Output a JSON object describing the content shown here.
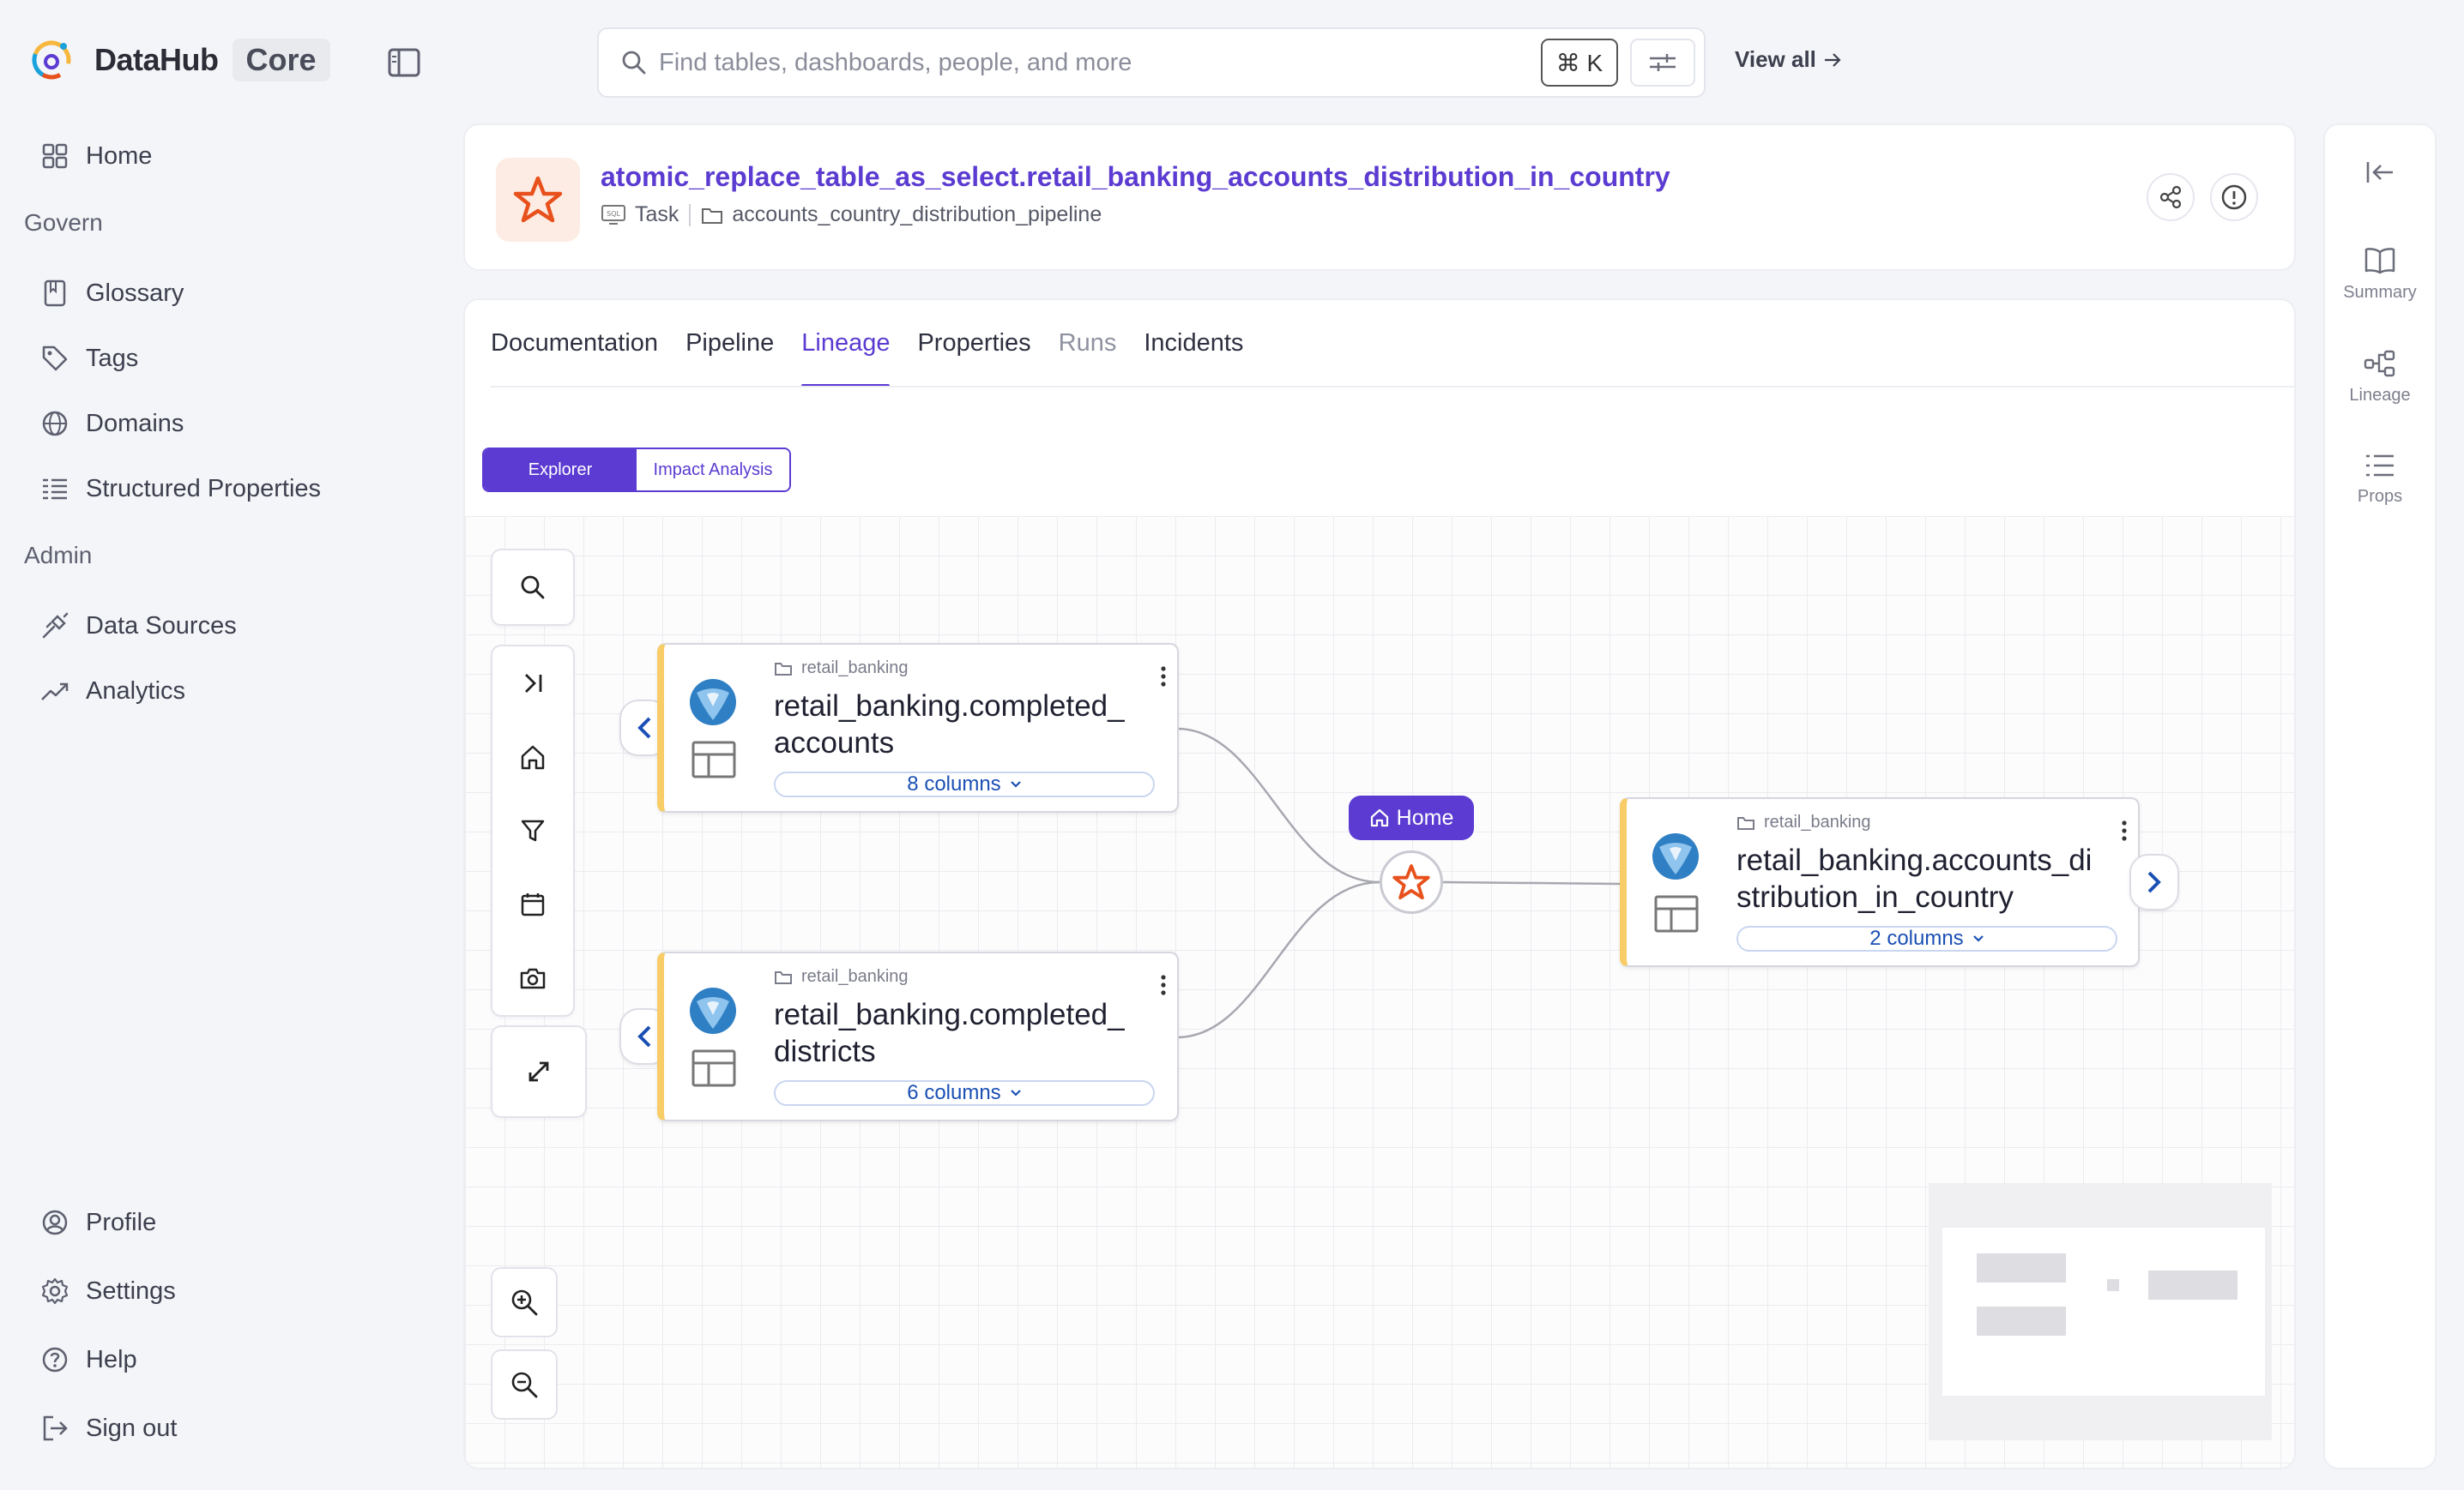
{
  "app": {
    "name": "DataHub",
    "edition": "Core"
  },
  "sidebar": {
    "home": "Home",
    "govern_heading": "Govern",
    "govern_items": [
      "Glossary",
      "Tags",
      "Domains",
      "Structured Properties"
    ],
    "admin_heading": "Admin",
    "admin_items": [
      "Data Sources",
      "Analytics"
    ],
    "bottom_items": [
      "Profile",
      "Settings",
      "Help",
      "Sign out"
    ]
  },
  "search": {
    "placeholder": "Find tables, dashboards, people, and more",
    "shortcut": "⌘ K",
    "view_all": "View all"
  },
  "entity": {
    "title": "atomic_replace_table_as_select.retail_banking_accounts_distribution_in_country",
    "type": "Task",
    "pipeline": "accounts_country_distribution_pipeline",
    "accent_color": "#5b3bd1",
    "icon_color": "#e8501c"
  },
  "tabs": [
    "Documentation",
    "Pipeline",
    "Lineage",
    "Properties",
    "Runs",
    "Incidents"
  ],
  "active_tab": "Lineage",
  "lineage": {
    "mode_explorer": "Explorer",
    "mode_impact": "Impact Analysis",
    "home_label": "Home",
    "nodes": [
      {
        "folder": "retail_banking",
        "name": "retail_banking.completed_accounts",
        "name_line1": "retail_banking.completed_",
        "name_line2": "accounts",
        "columns": "8 columns"
      },
      {
        "folder": "retail_banking",
        "name": "retail_banking.completed_districts",
        "name_line1": "retail_banking.completed_",
        "name_line2": "districts",
        "columns": "6 columns"
      },
      {
        "folder": "retail_banking",
        "name": "retail_banking.accounts_distribution_in_country",
        "name_line1": "retail_banking.accounts_di",
        "name_line2": "stribution_in_country",
        "columns": "2 columns"
      }
    ]
  },
  "right_rail": [
    "Summary",
    "Lineage",
    "Props"
  ]
}
